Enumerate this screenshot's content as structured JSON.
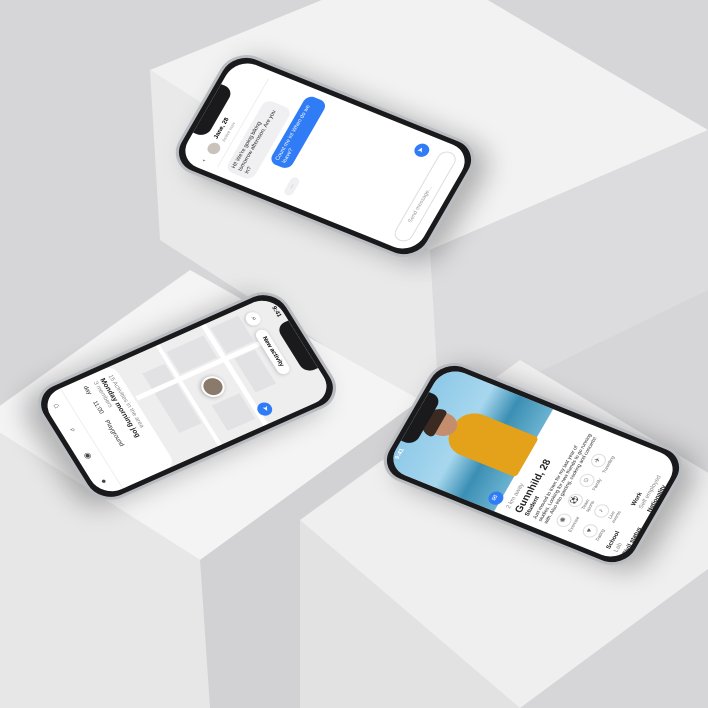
{
  "scene": {
    "background_color": "#d9d9da",
    "block_light": "#f4f4f5",
    "block_mid": "#e6e6e7",
    "block_dark": "#cbcbcd"
  },
  "chat_phone": {
    "contact_name": "Jane, 28",
    "contact_status": "Active now",
    "incoming_message": "Hi! We're going biking tomorrow afternoon. Are you in?",
    "outgoing_message": "Count me in! When do we leave?",
    "typing_indicator": "...",
    "composer_placeholder": "Send message...",
    "send_icon": "send-arrow-icon",
    "accent": "#2f7cf6"
  },
  "map_phone": {
    "time": "9:41",
    "new_activity_label": "New activity",
    "activities_count": "15 Activities in the area",
    "activity_title": "Monday morning jog",
    "activity_members": "3 members",
    "activity_day": "day",
    "activity_time": "11:00",
    "activity_place": "Playground",
    "tab_icons": [
      "home-icon",
      "search-icon",
      "map-pin-icon",
      "profile-icon"
    ]
  },
  "profile_phone": {
    "time": "9:41",
    "distance": "2 km away",
    "name_age": "Gunnhild, 28",
    "occupation": "Student",
    "bio": "Just moved to town for my last year of studies. Looking for new friends to go running with. Also into gaming, cooking and concerts!",
    "interests": [
      {
        "label": "Exercise",
        "icon": "exercise-icon"
      },
      {
        "label": "Team sports",
        "icon": "team-sports-icon"
      },
      {
        "label": "Family",
        "icon": "family-icon"
      },
      {
        "label": "Travelling",
        "icon": "travel-icon"
      },
      {
        "label": "Dating",
        "icon": "dating-icon"
      },
      {
        "label": "Live events",
        "icon": "live-events-icon"
      }
    ],
    "details": [
      {
        "label": "School",
        "value": "Lab"
      },
      {
        "label": "Work",
        "value": "Self employed"
      },
      {
        "label": "Civil status",
        "value": ""
      },
      {
        "label": "Nationality",
        "value": ""
      }
    ]
  }
}
